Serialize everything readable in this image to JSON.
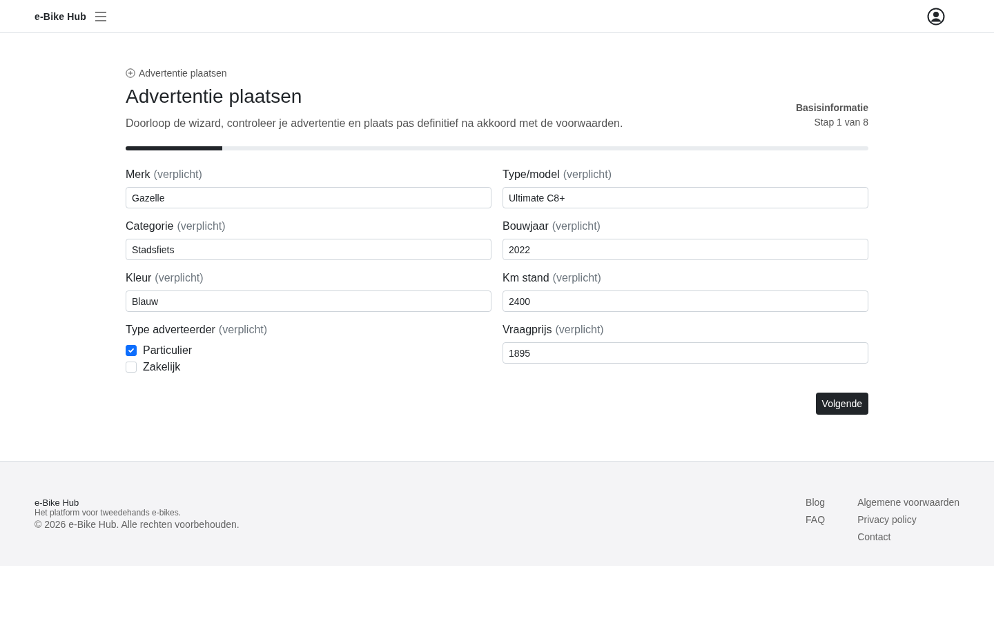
{
  "header": {
    "logo": "e-Bike Hub"
  },
  "breadcrumb": "Advertentie plaatsen",
  "title": "Advertentie plaatsen",
  "intro": "Doorloop de wizard, controleer je advertentie en plaats pas definitief na akkoord met de voorwaarden.",
  "step": {
    "name": "Basisinformatie",
    "counter": "Stap 1 van 8",
    "level": 0.13
  },
  "fields": [
    {
      "kind": "text",
      "label": "Merk",
      "note": "(verplicht)",
      "value": "Gazelle"
    },
    {
      "kind": "text",
      "label": "Type/model",
      "note": "(verplicht)",
      "value": "Ultimate C8+"
    },
    {
      "kind": "text",
      "label": "Categorie",
      "note": "(verplicht)",
      "value": "Stadsfiets"
    },
    {
      "kind": "text",
      "label": "Bouwjaar",
      "note": "(verplicht)",
      "value": "2022"
    },
    {
      "kind": "text",
      "label": "Kleur",
      "note": "(verplicht)",
      "value": "Blauw"
    },
    {
      "kind": "text",
      "label": "Km stand",
      "note": "(verplicht)",
      "value": "2400"
    },
    {
      "kind": "checkboxes",
      "label": "Type adverteerder",
      "note": "(verplicht)",
      "options": [
        {
          "label": "Particulier",
          "checked": true
        },
        {
          "label": "Zakelijk",
          "checked": false
        }
      ]
    },
    {
      "kind": "text",
      "label": "Vraagprijs",
      "note": "(verplicht)",
      "value": "1895"
    }
  ],
  "next_button": "Volgende",
  "footer": {
    "brand": "e-Bike Hub",
    "tagline": "Het platform voor tweedehands e-bikes.",
    "copyright": "© 2026 e-Bike Hub. Alle rechten voorbehouden.",
    "link_columns": [
      [
        "Blog",
        "FAQ"
      ],
      [
        "Algemene voorwaarden",
        "Privacy policy",
        "Contact"
      ]
    ]
  }
}
